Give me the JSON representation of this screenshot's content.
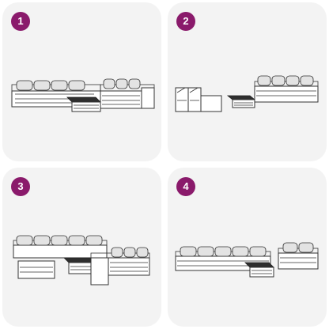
{
  "colors": {
    "page_background": "#ffffff",
    "panel_background": "#f3f3f3",
    "badge_background": "#8a1a6b",
    "badge_text": "#ffffff",
    "line_art": "#333333",
    "tabletop": "#2e2e2e"
  },
  "options": [
    {
      "number": "1"
    },
    {
      "number": "2"
    },
    {
      "number": "3"
    },
    {
      "number": "4"
    }
  ]
}
